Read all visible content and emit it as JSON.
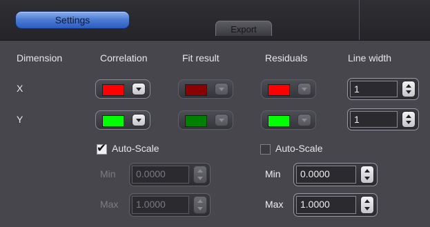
{
  "tabs": {
    "settings": "Settings",
    "export": "Export"
  },
  "headers": {
    "dimension": "Dimension",
    "correlation": "Correlation",
    "fit_result": "Fit result",
    "residuals": "Residuals",
    "line_width": "Line width"
  },
  "rows": [
    {
      "label": "X",
      "correlation_color": "#ff0000",
      "fit_color": "#8b0000",
      "residual_color": "#ff0000",
      "line_width": "1"
    },
    {
      "label": "Y",
      "correlation_color": "#00ff00",
      "fit_color": "#008000",
      "residual_color": "#00ff00",
      "line_width": "1"
    }
  ],
  "left_scale": {
    "autoscale_label": "Auto-Scale",
    "autoscale_checked": true,
    "min_label": "Min",
    "min_value": "0.0000",
    "max_label": "Max",
    "max_value": "1.0000",
    "fields_enabled": false
  },
  "right_scale": {
    "autoscale_label": "Auto-Scale",
    "autoscale_checked": false,
    "min_label": "Min",
    "min_value": "0.0000",
    "max_label": "Max",
    "max_value": "1.0000",
    "fields_enabled": true
  }
}
